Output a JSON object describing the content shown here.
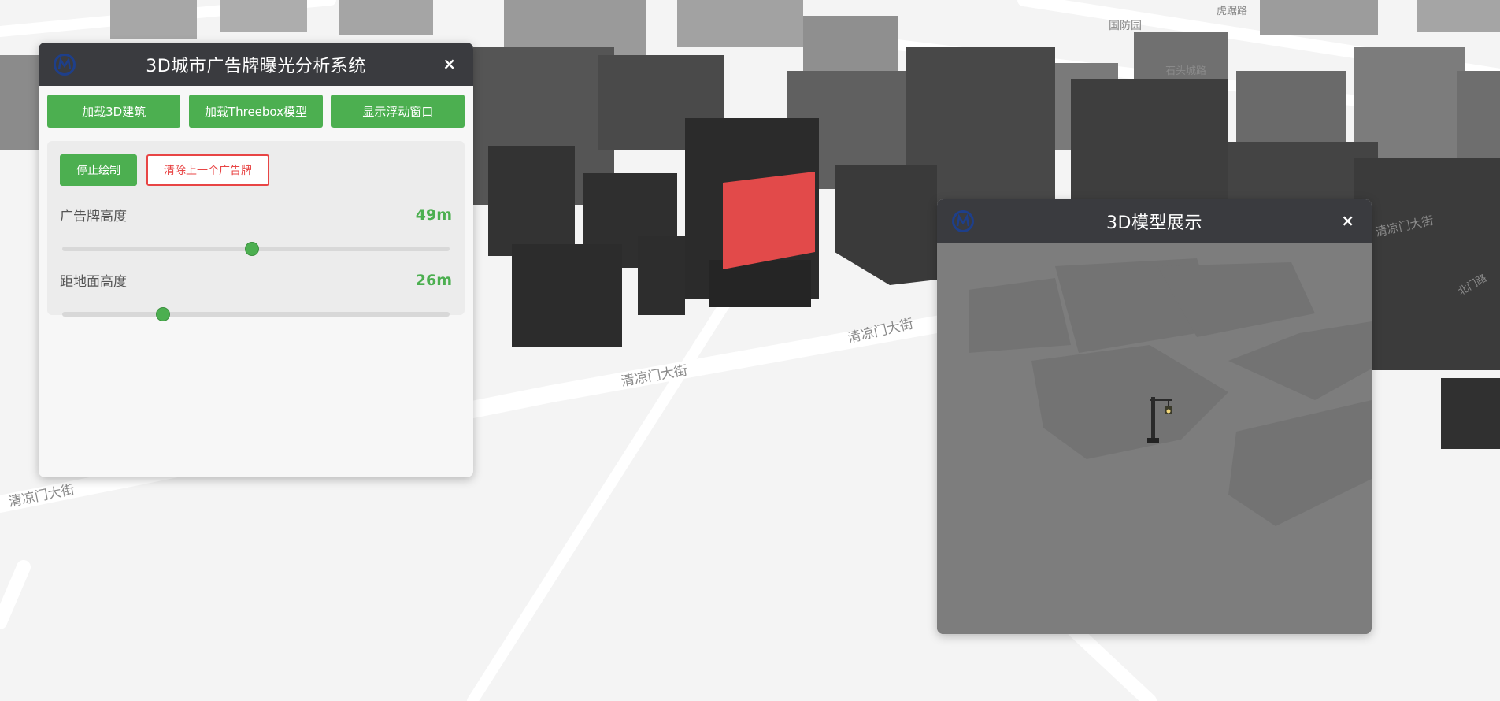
{
  "map": {
    "road_labels": [
      "清凉门大街",
      "清凉门大街",
      "清凉门大街",
      "清凉门大街",
      "国防园",
      "石头城路",
      "虎踞路",
      "北门路"
    ]
  },
  "control_panel": {
    "title": "3D城市广告牌曝光分析系统",
    "close": "×",
    "buttons": {
      "load_buildings": "加载3D建筑",
      "load_threebox": "加载Threebox模型",
      "show_float": "显示浮动窗口"
    },
    "draw": {
      "stop_label": "停止绘制",
      "clear_label": "清除上一个广告牌"
    },
    "billboard_height": {
      "label": "广告牌高度",
      "value": "49m",
      "fraction": 0.49
    },
    "ground_height": {
      "label": "距地面高度",
      "value": "26m",
      "fraction": 0.26
    }
  },
  "model_panel": {
    "title": "3D模型展示",
    "close": "×"
  },
  "colors": {
    "accent": "#4caf50",
    "danger": "#e84545",
    "header": "#3a3b3f",
    "billboard": "#e24a4a"
  }
}
